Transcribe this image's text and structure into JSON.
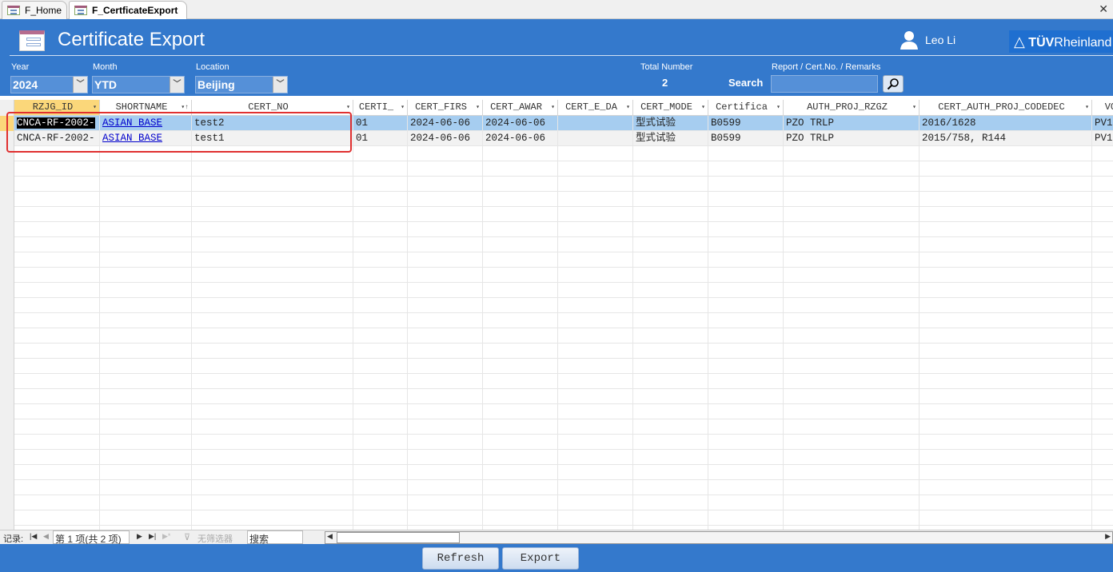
{
  "tabs": [
    {
      "label": "F_Home",
      "active": false
    },
    {
      "label": "F_CertficateExport",
      "active": true
    }
  ],
  "header": {
    "title": "Certificate Export",
    "user": "Leo Li",
    "logo": "TÜVRheinland"
  },
  "filters": {
    "year": {
      "label": "Year",
      "value": "2024"
    },
    "month": {
      "label": "Month",
      "value": "YTD"
    },
    "location": {
      "label": "Location",
      "value": "Beijing"
    },
    "total": {
      "label": "Total Number",
      "value": "2"
    },
    "search": {
      "label": "Search",
      "field_label": "Report / Cert.No. / Remarks",
      "value": ""
    }
  },
  "grid": {
    "columns": [
      "RZJG_ID",
      "SHORTNAME",
      "CERT_NO",
      "CERTI_",
      "CERT_FIRS",
      "CERT_AWAR",
      "CERT_E_DA",
      "CERT_MODE",
      "Certifica",
      "AUTH_PROJ_RZGZ",
      "CERT_AUTH_PROJ_CODEDEC",
      "VOL"
    ],
    "rows": [
      [
        "CNCA-RF-2002-",
        "ASIAN BASE",
        "test2",
        "01",
        "2024-06-06",
        "2024-06-06",
        "",
        "型式试验",
        "B0599",
        "PZO TRLP",
        "2016/1628",
        "PV1"
      ],
      [
        "CNCA-RF-2002-",
        "ASIAN BASE",
        "test1",
        "01",
        "2024-06-06",
        "2024-06-06",
        "",
        "型式试验",
        "B0599",
        "PZO TRLP",
        "2015/758, R144",
        "PV1"
      ]
    ]
  },
  "nav": {
    "record_label": "记录:",
    "position": "第 1 项(共 2 项)",
    "filter": "无筛选器",
    "search": "搜索"
  },
  "buttons": {
    "refresh": "Refresh",
    "export": "Export"
  },
  "colors": {
    "header_bg": "#3479cc",
    "selected_row": "#a6cdf0",
    "highlight_box": "#e03030"
  }
}
